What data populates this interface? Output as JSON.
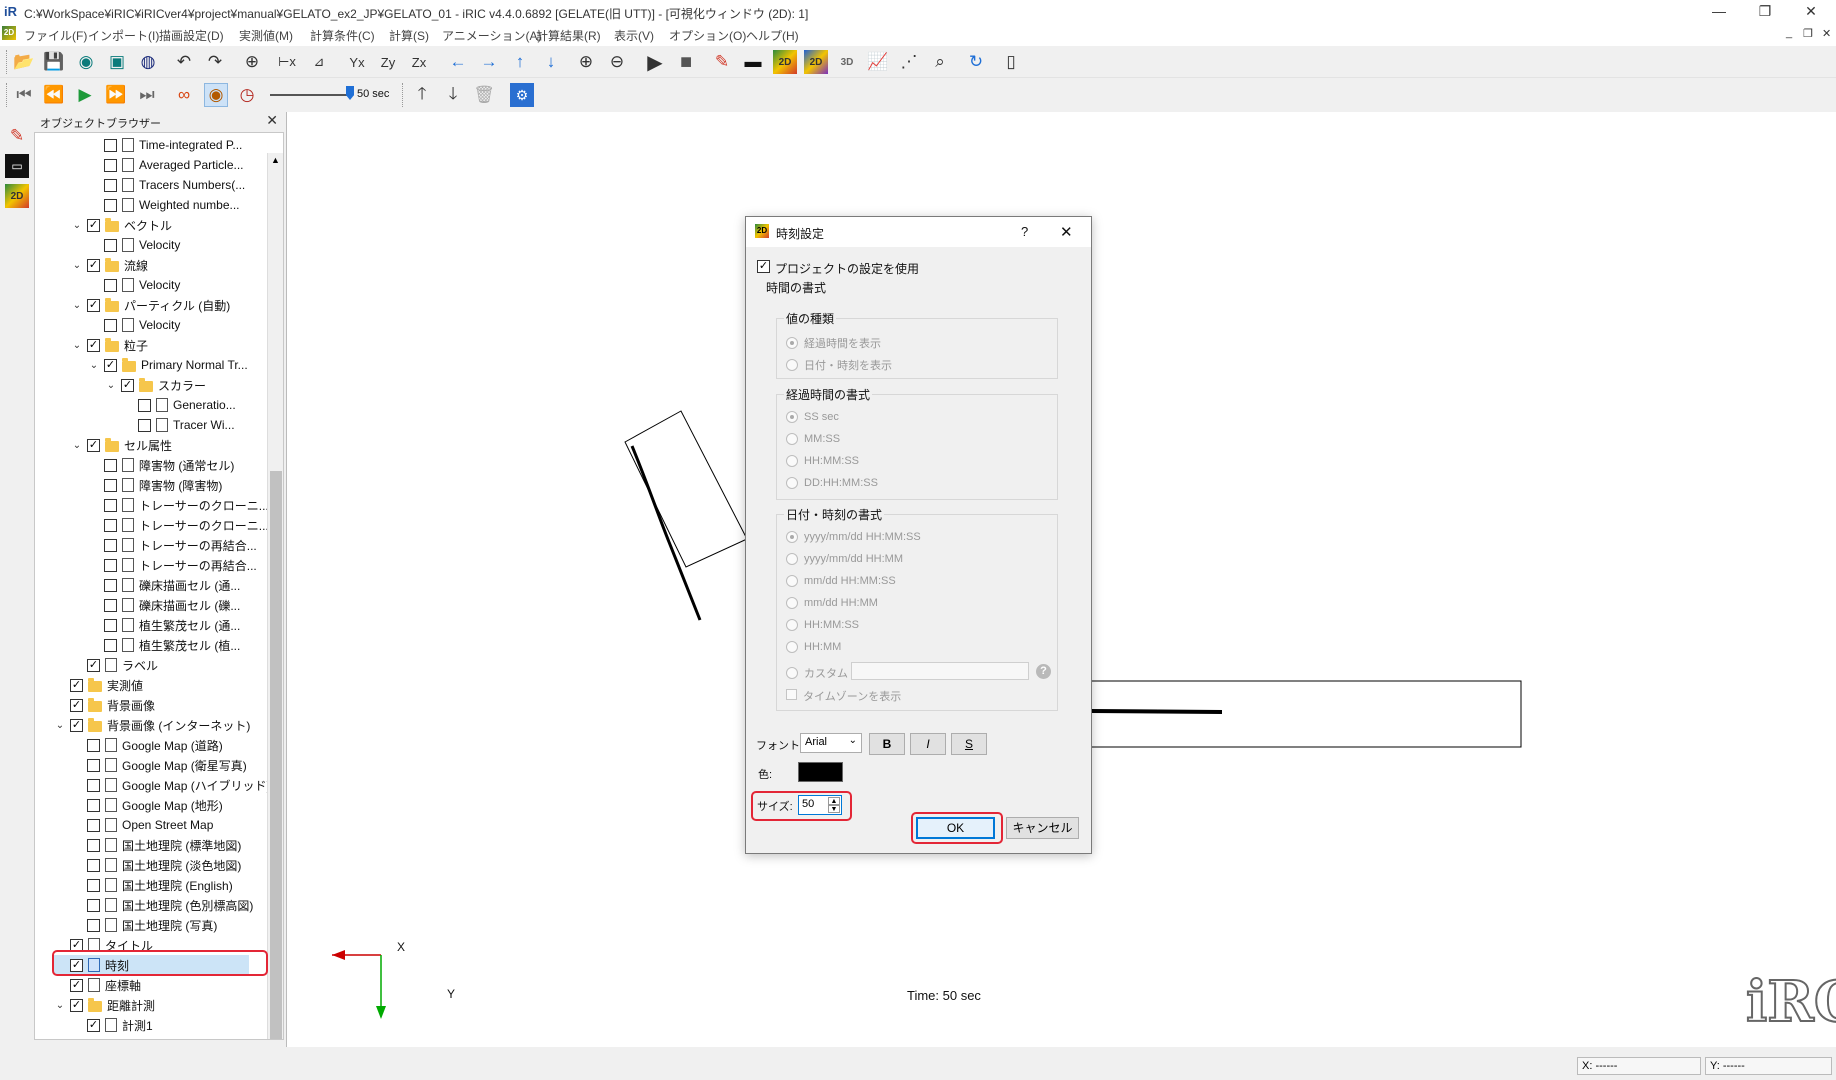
{
  "window": {
    "title": "C:¥WorkSpace¥iRIC¥iRICver4¥project¥manual¥GELATO_ex2_JP¥GELATO_01 - iRIC v4.4.0.6892 [GELATE(旧 UTT)] - [可視化ウィンドウ (2D): 1]",
    "app_icon": "iRIC",
    "controls": {
      "minimize": "—",
      "restore": "❐",
      "close": "✕"
    }
  },
  "menubar": {
    "items": [
      "ファイル(F)",
      "インポート(I)",
      "描画設定(D)",
      "実測値(M)",
      "計算条件(C)",
      "計算(S)",
      "アニメーション(A)",
      "計算結果(R)",
      "表示(V)",
      "オプション(O)",
      "ヘルプ(H)"
    ],
    "mdi": {
      "minimize": "_",
      "restore": "❐",
      "close": "✕"
    }
  },
  "toolbar": {
    "timeline_value": "50 sec",
    "timeline_fraction": 1.0
  },
  "object_browser": {
    "title": "オブジェクトブラウザー",
    "close": "✕",
    "rows": [
      {
        "indent": 3,
        "exp": "",
        "checked": false,
        "icon": "doc",
        "label": "Time-integrated P..."
      },
      {
        "indent": 3,
        "exp": "",
        "checked": false,
        "icon": "doc",
        "label": "Averaged Particle..."
      },
      {
        "indent": 3,
        "exp": "",
        "checked": false,
        "icon": "doc",
        "label": "Tracers Numbers(..."
      },
      {
        "indent": 3,
        "exp": "",
        "checked": false,
        "icon": "doc",
        "label": "Weighted numbe..."
      },
      {
        "indent": 2,
        "exp": "⌄",
        "checked": true,
        "icon": "folder",
        "label": "ベクトル"
      },
      {
        "indent": 3,
        "exp": "",
        "checked": false,
        "icon": "doc",
        "label": "Velocity"
      },
      {
        "indent": 2,
        "exp": "⌄",
        "checked": true,
        "icon": "folder",
        "label": "流線"
      },
      {
        "indent": 3,
        "exp": "",
        "checked": false,
        "icon": "doc",
        "label": "Velocity"
      },
      {
        "indent": 2,
        "exp": "⌄",
        "checked": true,
        "icon": "folder",
        "label": "パーティクル (自動)"
      },
      {
        "indent": 3,
        "exp": "",
        "checked": false,
        "icon": "doc",
        "label": "Velocity"
      },
      {
        "indent": 2,
        "exp": "⌄",
        "checked": true,
        "icon": "folder",
        "label": "粒子"
      },
      {
        "indent": 3,
        "exp": "⌄",
        "checked": true,
        "icon": "folder",
        "label": "Primary Normal Tr..."
      },
      {
        "indent": 4,
        "exp": "⌄",
        "checked": true,
        "icon": "folder",
        "label": "スカラー"
      },
      {
        "indent": 5,
        "exp": "",
        "checked": false,
        "icon": "doc",
        "label": "Generatio..."
      },
      {
        "indent": 5,
        "exp": "",
        "checked": false,
        "icon": "doc",
        "label": "Tracer Wi..."
      },
      {
        "indent": 2,
        "exp": "⌄",
        "checked": true,
        "icon": "folder",
        "label": "セル属性"
      },
      {
        "indent": 3,
        "exp": "",
        "checked": false,
        "icon": "doc",
        "label": "障害物 (通常セル)"
      },
      {
        "indent": 3,
        "exp": "",
        "checked": false,
        "icon": "doc",
        "label": "障害物 (障害物)"
      },
      {
        "indent": 3,
        "exp": "",
        "checked": false,
        "icon": "doc",
        "label": "トレーサーのクローニ..."
      },
      {
        "indent": 3,
        "exp": "",
        "checked": false,
        "icon": "doc",
        "label": "トレーサーのクローニ..."
      },
      {
        "indent": 3,
        "exp": "",
        "checked": false,
        "icon": "doc",
        "label": "トレーサーの再結合..."
      },
      {
        "indent": 3,
        "exp": "",
        "checked": false,
        "icon": "doc",
        "label": "トレーサーの再結合..."
      },
      {
        "indent": 3,
        "exp": "",
        "checked": false,
        "icon": "doc",
        "label": "礫床描画セル (通..."
      },
      {
        "indent": 3,
        "exp": "",
        "checked": false,
        "icon": "doc",
        "label": "礫床描画セル (礫..."
      },
      {
        "indent": 3,
        "exp": "",
        "checked": false,
        "icon": "doc",
        "label": "植生繁茂セル (通..."
      },
      {
        "indent": 3,
        "exp": "",
        "checked": false,
        "icon": "doc",
        "label": "植生繁茂セル (植..."
      },
      {
        "indent": 2,
        "exp": "",
        "checked": true,
        "icon": "doc",
        "label": "ラベル"
      },
      {
        "indent": 1,
        "exp": "",
        "checked": true,
        "icon": "folder",
        "label": "実測値"
      },
      {
        "indent": 1,
        "exp": "",
        "checked": true,
        "icon": "folder",
        "label": "背景画像"
      },
      {
        "indent": 1,
        "exp": "⌄",
        "checked": true,
        "icon": "folder",
        "label": "背景画像 (インターネット)"
      },
      {
        "indent": 2,
        "exp": "",
        "checked": false,
        "icon": "doc",
        "label": "Google Map (道路)"
      },
      {
        "indent": 2,
        "exp": "",
        "checked": false,
        "icon": "doc",
        "label": "Google Map (衛星写真)"
      },
      {
        "indent": 2,
        "exp": "",
        "checked": false,
        "icon": "doc",
        "label": "Google Map (ハイブリッド)"
      },
      {
        "indent": 2,
        "exp": "",
        "checked": false,
        "icon": "doc",
        "label": "Google Map (地形)"
      },
      {
        "indent": 2,
        "exp": "",
        "checked": false,
        "icon": "doc",
        "label": "Open Street Map"
      },
      {
        "indent": 2,
        "exp": "",
        "checked": false,
        "icon": "doc",
        "label": "国土地理院 (標準地図)"
      },
      {
        "indent": 2,
        "exp": "",
        "checked": false,
        "icon": "doc",
        "label": "国土地理院 (淡色地図)"
      },
      {
        "indent": 2,
        "exp": "",
        "checked": false,
        "icon": "doc",
        "label": "国土地理院 (English)"
      },
      {
        "indent": 2,
        "exp": "",
        "checked": false,
        "icon": "doc",
        "label": "国土地理院 (色別標高図)"
      },
      {
        "indent": 2,
        "exp": "",
        "checked": false,
        "icon": "doc",
        "label": "国土地理院 (写真)"
      },
      {
        "indent": 1,
        "exp": "",
        "checked": true,
        "icon": "doc",
        "label": "タイトル"
      },
      {
        "indent": 1,
        "exp": "",
        "checked": true,
        "icon": "docblue",
        "label": "時刻",
        "selected": true
      },
      {
        "indent": 1,
        "exp": "",
        "checked": true,
        "icon": "doc",
        "label": "座標軸"
      },
      {
        "indent": 1,
        "exp": "⌄",
        "checked": true,
        "icon": "folder",
        "label": "距離計測"
      },
      {
        "indent": 2,
        "exp": "",
        "checked": true,
        "icon": "doc",
        "label": "計測1"
      }
    ]
  },
  "viewport": {
    "axis_x_label": "X",
    "axis_y_label": "Y",
    "time_text": "Time: 50 sec"
  },
  "dialog": {
    "title": "時刻設定",
    "help": "?",
    "close": "✕",
    "use_project_setting": "プロジェクトの設定を使用",
    "use_project_checked": true,
    "time_format_group": "時間の書式",
    "value_type_group": "値の種類",
    "value_types": [
      "経過時間を表示",
      "日付・時刻を表示"
    ],
    "value_type_selected": 0,
    "elapsed_group": "経過時間の書式",
    "elapsed_formats": [
      "SS sec",
      "MM:SS",
      "HH:MM:SS",
      "DD:HH:MM:SS"
    ],
    "elapsed_selected": 0,
    "datetime_group": "日付・時刻の書式",
    "datetime_formats": [
      "yyyy/mm/dd HH:MM:SS",
      "yyyy/mm/dd HH:MM",
      "mm/dd HH:MM:SS",
      "mm/dd HH:MM",
      "HH:MM:SS",
      "HH:MM",
      "カスタム"
    ],
    "datetime_selected": 0,
    "custom_value": "",
    "show_timezone": "タイムゾーンを表示",
    "font_label": "フォント:",
    "font_value": "Arial",
    "bold": "B",
    "italic": "I",
    "shadow": "S",
    "color_label": "色:",
    "color_value": "#000000",
    "size_label": "サイズ:",
    "size_value": "50",
    "ok": "OK",
    "cancel": "キャンセル"
  },
  "statusbar": {
    "x": "X: ------",
    "y": "Y: ------"
  },
  "colors": {
    "highlight": "#e32636",
    "axis_x": "#cc0000",
    "axis_y": "#00aa00",
    "selected_button": "#0078d7"
  }
}
